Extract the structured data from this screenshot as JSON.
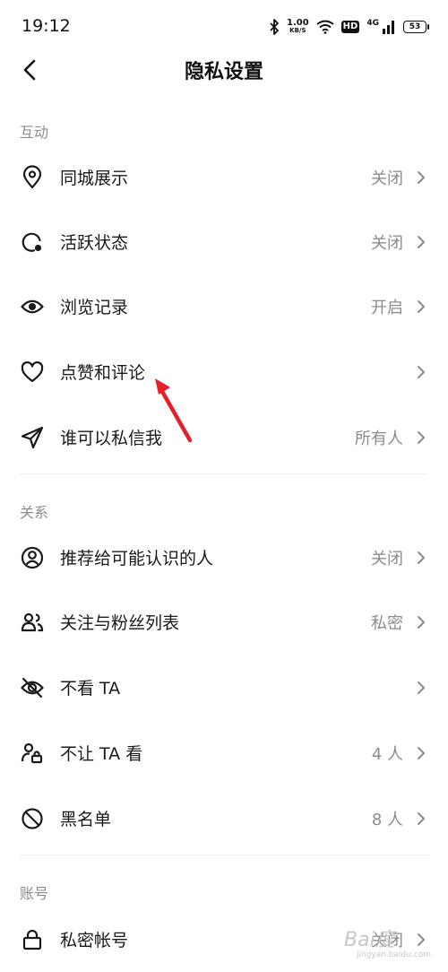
{
  "status_bar": {
    "time": "19:12",
    "speed_value": "1.00",
    "speed_unit": "KB/S",
    "hd": "HD",
    "network": "4G",
    "battery": "53",
    "icons": [
      "bluetooth-icon",
      "wifi-icon",
      "signal-icon",
      "battery-icon"
    ]
  },
  "header": {
    "title": "隐私设置",
    "back_icon": "chevron-left-icon"
  },
  "sections": {
    "interaction": {
      "label": "互动",
      "items": [
        {
          "label": "同城展示",
          "value": "关闭",
          "icon": "location-pin-icon"
        },
        {
          "label": "活跃状态",
          "value": "关闭",
          "icon": "activity-status-icon"
        },
        {
          "label": "浏览记录",
          "value": "开启",
          "icon": "eye-icon"
        },
        {
          "label": "点赞和评论",
          "value": "",
          "icon": "heart-icon"
        },
        {
          "label": "谁可以私信我",
          "value": "所有人",
          "icon": "send-icon"
        }
      ]
    },
    "relations": {
      "label": "关系",
      "items": [
        {
          "label": "推荐给可能认识的人",
          "value": "关闭",
          "icon": "user-circle-icon"
        },
        {
          "label": "关注与粉丝列表",
          "value": "私密",
          "icon": "users-icon"
        },
        {
          "label": "不看 TA",
          "value": "",
          "icon": "eye-off-icon"
        },
        {
          "label": "不让 TA 看",
          "value": "4 人",
          "icon": "user-lock-icon"
        },
        {
          "label": "黑名单",
          "value": "8 人",
          "icon": "block-icon"
        }
      ]
    },
    "account": {
      "label": "账号",
      "items": [
        {
          "label": "私密帐号",
          "value": "关闭",
          "icon": "lock-icon"
        }
      ]
    }
  },
  "watermark": {
    "logo": "Bai度",
    "url": "jingyan.baidu.com"
  },
  "colors": {
    "accent_annotation": "#e5202a",
    "muted_text": "#8c8c8c",
    "primary_text": "#1a1a1a"
  }
}
